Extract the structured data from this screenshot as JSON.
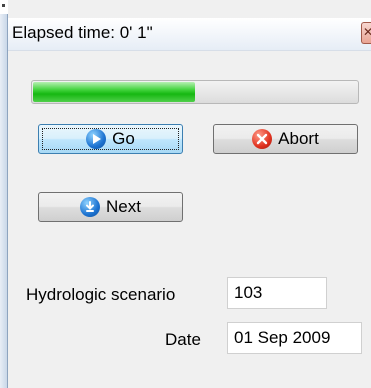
{
  "window": {
    "title": "Elapsed time:  0' 1\"",
    "close_glyph": "✕"
  },
  "progress": {
    "value_percent": 50
  },
  "buttons": {
    "go_label": "Go",
    "abort_label": "Abort",
    "next_label": "Next"
  },
  "icons": {
    "go": "play-circle-icon",
    "abort": "close-circle-icon",
    "next": "next-circle-icon"
  },
  "fields": {
    "hydrologic_scenario_label": "Hydrologic scenario",
    "hydrologic_scenario_value": "103",
    "date_label": "Date",
    "date_value": "01 Sep 2009"
  },
  "colors": {
    "progress_fill": "#16b812",
    "go_icon": "#1d73d1",
    "abort_icon": "#e0321f"
  }
}
